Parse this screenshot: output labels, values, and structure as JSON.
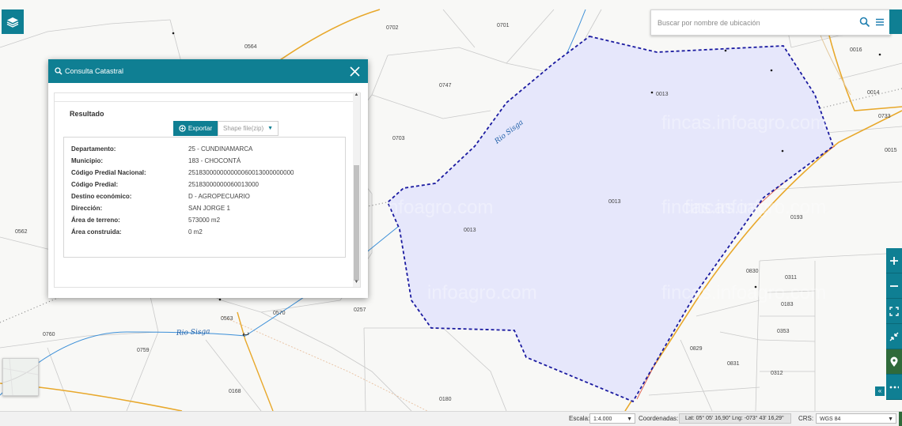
{
  "map": {
    "labels": [
      "0702",
      "0701",
      "0564",
      "0747",
      "0013",
      "0016",
      "0014",
      "0733",
      "0015",
      "0703",
      "0013",
      "0013",
      "0193",
      "0562",
      "0830",
      "0311",
      "0183",
      "0353",
      "0563",
      "0570",
      "0257",
      "0760",
      "0759",
      "0829",
      "0831",
      "0312",
      "0168",
      "0180"
    ],
    "river_labels": [
      "Rio Sisga",
      "Rio Sisga"
    ],
    "watermarks": [
      "fincas.infoagro.com",
      "fincas.infoagro.com",
      "nfoagro.com",
      "fincas.info",
      "infoagro.com",
      "fincas.infoagro.com"
    ]
  },
  "search": {
    "placeholder": "Buscar por nombre de ubicación"
  },
  "icons": {
    "layers": "layers-icon",
    "search": "search-icon",
    "menu": "menu-icon",
    "zoom_in": "plus-icon",
    "zoom_out": "minus-icon",
    "fullscreen": "expand-icon",
    "minimize": "shrink-icon",
    "location": "location-pin-icon",
    "more": "more-icon",
    "close": "close-icon",
    "collapse": "double-chevron-left-icon"
  },
  "colors": {
    "accent": "#0f7f93",
    "parcel_fill": "#e6e7fb",
    "parcel_border": "#1a1aa0",
    "river": "#3b8fd8",
    "road": "#e8a82b"
  },
  "dialog": {
    "title": "Consulta Catastral",
    "result_heading": "Resultado",
    "export_label": "Exportar",
    "shape_select": "Shape file(zip)",
    "fields": [
      {
        "label": "Departamento:",
        "value": "25 - CUNDINAMARCA"
      },
      {
        "label": "Municipio:",
        "value": "183 - CHOCONTÁ"
      },
      {
        "label": "Código Predial Nacional:",
        "value": "251830000000000060013000000000"
      },
      {
        "label": "Código Predial:",
        "value": "25183000000060013000"
      },
      {
        "label": "Destino económico:",
        "value": "D - AGROPECUARIO"
      },
      {
        "label": "Dirección:",
        "value": "SAN JORGE 1"
      },
      {
        "label": "Área de terreno:",
        "value": "573000 m2"
      },
      {
        "label": "Área construida:",
        "value": "0 m2"
      }
    ]
  },
  "statusbar": {
    "scale_label": "Escala:",
    "scale_value": "1:4.000",
    "coords_label": "Coordenadas:",
    "coords_value": "Lat: 05° 05' 16,90\" Lng: -073° 43' 16,29\"",
    "crs_label": "CRS:",
    "crs_value": "WGS 84"
  }
}
